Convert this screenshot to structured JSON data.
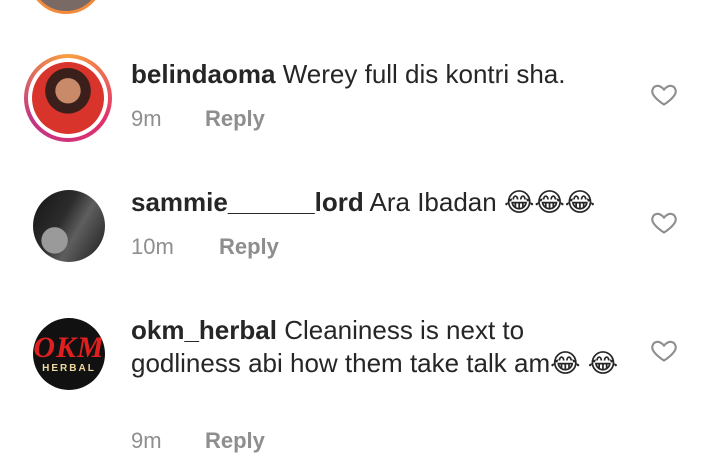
{
  "comments": [
    {
      "username": "belindaoma",
      "text": "Werey full dis kontri sha.",
      "time": "9m",
      "reply_label": "Reply",
      "avatar": "profile-photo-story-ring"
    },
    {
      "username": "sammie______lord",
      "text": "Ara Ibadan 😂😂😂",
      "time": "10m",
      "reply_label": "Reply",
      "avatar": "profile-photo-bw"
    },
    {
      "username": "okm_herbal",
      "text": "Cleaniness is next to godliness abi how them take talk am😂 😂",
      "time": "9m",
      "reply_label": "Reply",
      "avatar": "okm-herbal-logo"
    }
  ],
  "icons": {
    "like": "heart-outline-icon"
  },
  "colors": {
    "text": "#262626",
    "meta": "#8e8e8e",
    "ring": "#e1306c"
  }
}
